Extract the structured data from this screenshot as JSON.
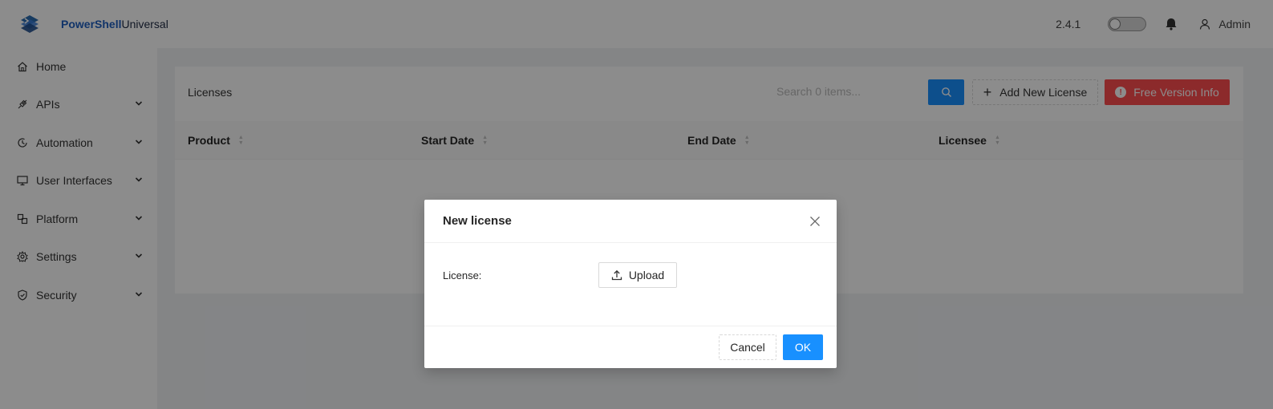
{
  "app": {
    "brand_bold": "PowerShell",
    "brand_rest": "Universal",
    "version": "2.4.1",
    "user": "Admin"
  },
  "sidebar": {
    "items": [
      {
        "label": "Home",
        "icon": "home-icon",
        "expandable": false
      },
      {
        "label": "APIs",
        "icon": "api-icon",
        "expandable": true
      },
      {
        "label": "Automation",
        "icon": "automation-icon",
        "expandable": true
      },
      {
        "label": "User Interfaces",
        "icon": "monitor-icon",
        "expandable": true
      },
      {
        "label": "Platform",
        "icon": "platform-icon",
        "expandable": true
      },
      {
        "label": "Settings",
        "icon": "gear-icon",
        "expandable": true
      },
      {
        "label": "Security",
        "icon": "shield-icon",
        "expandable": true
      }
    ]
  },
  "licenses": {
    "title": "Licenses",
    "search_placeholder": "Search 0 items...",
    "add_label": "Add New License",
    "free_label": "Free Version Info",
    "columns": [
      "Product",
      "Start Date",
      "End Date",
      "Licensee"
    ],
    "rows": []
  },
  "modal": {
    "title": "New license",
    "field_label": "License:",
    "upload_label": "Upload",
    "cancel_label": "Cancel",
    "ok_label": "OK"
  },
  "colors": {
    "primary": "#1890ff",
    "danger": "#ff4d4f",
    "brand": "#1f5fbf"
  }
}
